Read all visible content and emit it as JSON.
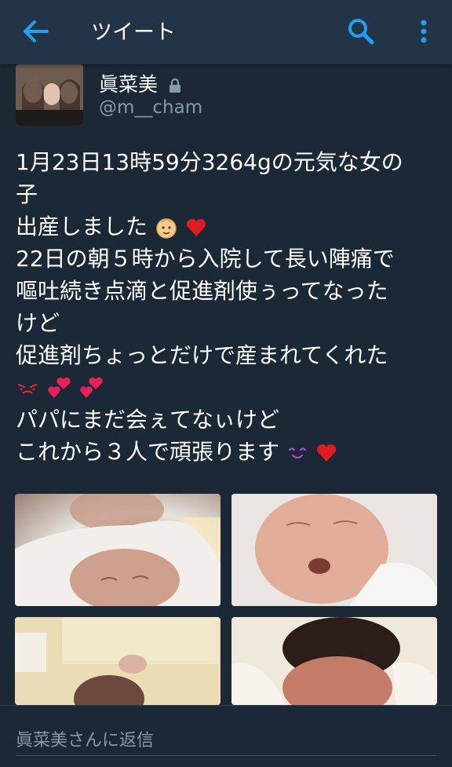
{
  "appbar": {
    "title": "ツイート",
    "back_icon": "arrow-left-icon",
    "search_icon": "search-icon",
    "more_icon": "more-vertical-icon",
    "accent_color": "#1da1f2"
  },
  "tweet": {
    "author_name": "眞菜美",
    "author_handle": "@m__cham",
    "protected_icon": "lock-icon",
    "text_lines": [
      "1月23日13時59分3264gの元気な女の",
      "子",
      "出産しました",
      "22日の朝５時から入院して長い陣痛で",
      "嘔吐続き点滴と促進剤使ぅってなった",
      "けど",
      "促進剤ちょっとだけで産まれてくれた",
      "",
      "パパにまだ会ぇてなぃけど",
      "これから３人で頑張ります"
    ],
    "emojis": [
      "baby-face-emoji",
      "red-heart-emoji",
      "crying-face-emoji",
      "two-hearts-emoji",
      "two-hearts-emoji",
      "smiling-face-emoji",
      "red-heart-emoji"
    ],
    "photos": [
      "baby-photo-1",
      "baby-photo-2",
      "baby-photo-3",
      "baby-photo-4"
    ]
  },
  "reply": {
    "placeholder": "眞菜美さんに返信"
  }
}
